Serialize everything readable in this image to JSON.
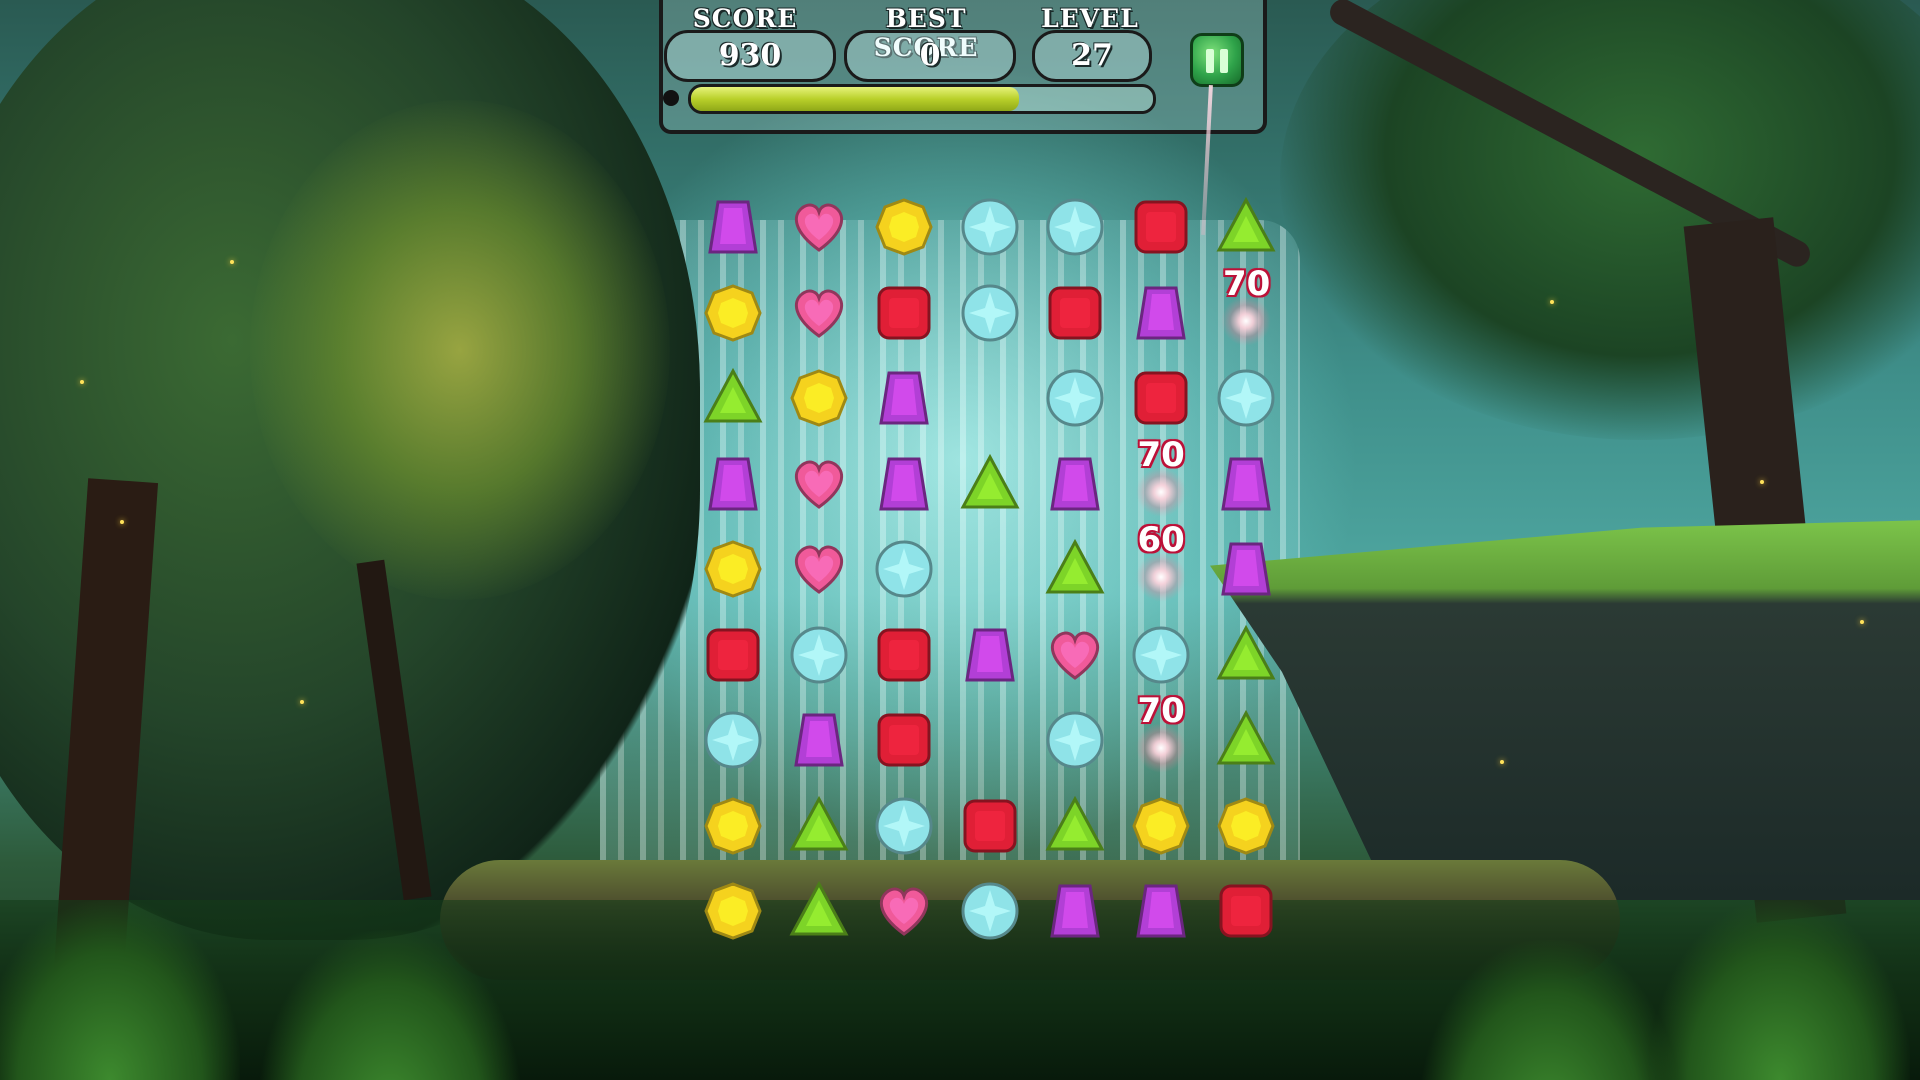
{
  "hud": {
    "score_label": "SCORE",
    "score_value": "930",
    "best_label": "BEST SCORE",
    "best_value": "0",
    "level_label": "LEVEL",
    "level_value": "27",
    "progress": 0.71
  },
  "colors": {
    "purple": "#b23fd6",
    "pink": "#f05a9a",
    "yellow": "#f5d21e",
    "teal": "#8fe3e8",
    "red": "#e01f36",
    "green": "#7dd428"
  },
  "board": {
    "cols": 7,
    "rows": 9,
    "grid": [
      [
        "purple",
        "pink",
        "yellow",
        "teal",
        "teal",
        "red",
        "green"
      ],
      [
        "yellow",
        "pink",
        "red",
        "teal",
        "red",
        "purple",
        null
      ],
      [
        "green",
        "yellow",
        "purple",
        null,
        "teal",
        "red",
        "teal"
      ],
      [
        "purple",
        "pink",
        "purple",
        "green",
        "purple",
        null,
        "purple"
      ],
      [
        "yellow",
        "pink",
        "teal",
        null,
        "green",
        null,
        "purple"
      ],
      [
        "red",
        "teal",
        "red",
        "purple",
        "pink",
        "teal",
        "green"
      ],
      [
        "teal",
        "purple",
        "red",
        null,
        "teal",
        null,
        "green"
      ],
      [
        "yellow",
        "green",
        "teal",
        "red",
        "green",
        "yellow",
        "yellow"
      ],
      [
        "yellow",
        "green",
        "pink",
        "teal",
        "purple",
        "purple",
        "red"
      ]
    ]
  },
  "popups": [
    {
      "text": "70",
      "col": 6,
      "row": 1
    },
    {
      "text": "70",
      "col": 5,
      "row": 3
    },
    {
      "text": "60",
      "col": 5,
      "row": 4
    },
    {
      "text": "70",
      "col": 5,
      "row": 6
    }
  ]
}
